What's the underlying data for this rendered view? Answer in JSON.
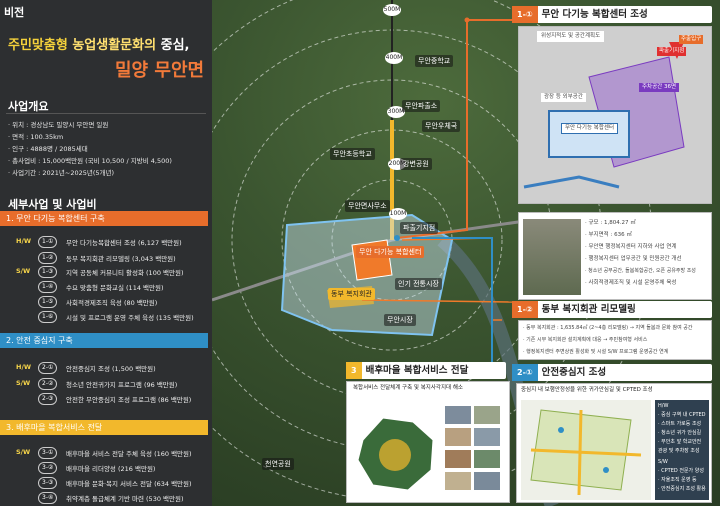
{
  "top_tag": "비전",
  "title": {
    "part1": "주민맞춤형",
    "part2": "농업생활문화의",
    "part3": "중심,",
    "main": "밀양 무안면"
  },
  "overview": {
    "heading": "사업개요",
    "lines": [
      "· 위치 : 경상남도 밀양시 무안면 일원",
      "· 면적 : 100.35km",
      "· 인구 : 4888명 / 2085세대",
      "· 총사업비 : 15,000백만원 (국비 10,500 / 지방비 4,500)",
      "· 사업기간 : 2021년~2025년(5개년)"
    ]
  },
  "details_heading": "세부사업 및 사업비",
  "sections": [
    {
      "title": "1. 무안 다기능 복합센터 구축",
      "rows": [
        {
          "cat": "H/W",
          "badge": "1-①",
          "text": "무안 다기능복합센터 조성 (6,127 백만원)"
        },
        {
          "cat": "",
          "badge": "1-②",
          "text": "동부 복지회관 리모델링 (3,043 백만원)"
        },
        {
          "cat": "S/W",
          "badge": "1-③",
          "text": "지역 공동체 커뮤니티 활성화 (100 백만원)"
        },
        {
          "cat": "",
          "badge": "1-④",
          "text": "수요 맞춤형 문화교실 (114 백만원)"
        },
        {
          "cat": "",
          "badge": "1-⑤",
          "text": "사회적경제조직 육성 (80 백만원)"
        },
        {
          "cat": "",
          "badge": "1-⑥",
          "text": "시설 및 프로그램 운영 주체 육성 (135 백만원)"
        }
      ]
    },
    {
      "title": "2. 안전 중심지 구축",
      "rows": [
        {
          "cat": "H/W",
          "badge": "2-①",
          "text": "안전중심지 조성 (1,500 백만원)"
        },
        {
          "cat": "S/W",
          "badge": "2-②",
          "text": "청소년 안전귀가지 프로그램 (96 백만원)"
        },
        {
          "cat": "",
          "badge": "2-③",
          "text": "안전한 무안중심지 조성 프로그램 (86 백만원)"
        }
      ]
    },
    {
      "title": "3. 배후마을 복합서비스 전달",
      "rows": [
        {
          "cat": "S/W",
          "badge": "3-①",
          "text": "배후마을 서비스 전달 주체 육성 (160 백만원)"
        },
        {
          "cat": "",
          "badge": "3-②",
          "text": "배후마을 리더양성 (216 백만원)"
        },
        {
          "cat": "",
          "badge": "3-③",
          "text": "배후마을 문화·복지 서비스 전달 (634 백만원)"
        },
        {
          "cat": "",
          "badge": "3-④",
          "text": "취약계층 돌급체계 기반 마련 (530 백만원)"
        }
      ]
    }
  ],
  "distances": [
    "500M",
    "400M",
    "300M",
    "200M",
    "100M"
  ],
  "map_labels": [
    "무안 다기능 복합센터",
    "동부 복지회관",
    "무안초등학교",
    "무안중학교",
    "무안파출소",
    "인기 전통시장",
    "무안면사무소",
    "파출기지점",
    "무안시장",
    "무안우체국",
    "강변공원",
    "천연공원"
  ],
  "panel1": {
    "num": "1-①",
    "title": "무안 다기능 복합센터 조성",
    "labels": [
      "위성지적도 및 공간계획도",
      "광장 등 외부공간",
      "무안 다기능 복합센터",
      "주차공간 36면",
      "파출기지점",
      "주출입구"
    ]
  },
  "panel2": {
    "num": "1-②",
    "title": "동부 복지회관 리모델링",
    "specs": [
      "· 규모 : 1,804.27 ㎡",
      "· 부지면적 : 636 ㎡",
      "· 무안면 행정복지센터 지하와 사업 연계",
      "· 행정복지센터 업무공간 및 민원공간 개선",
      "· 청소년 공부공간, 돌봄복합공간, 오픈 공유주방 조성",
      "· 사회적경제조직 및 시설 운영주체 육성"
    ],
    "lines": [
      "· 동부 복지회관 : 1,635.84㎡ (2~4층 리모델링) → 지역 돌봄과 문화 참여 공간",
      "· 기존 시부 복지회관 설치계획에 대응 → 주민참여형 서비스",
      "· 행정복지센터 주변상권 활성화 및 시설 S/W 프로그램 운영공간 연계"
    ]
  },
  "panel3": {
    "num": "3",
    "title": "배후마을 복합서비스 전달",
    "sub": "복합서비스 전달체계 구축 및 복지사각지대 해소"
  },
  "panel4": {
    "num": "2-①",
    "title": "안전중심지 조성",
    "sub": "중심지 내 보행안정성을 위한 귀가안심길 및 CPTED 조성",
    "items": [
      "H/W",
      "· 중심 구역 내 CPTED",
      "· 스마트 가로등 조성",
      "· 청소년 귀가 안심길",
      "· 무안초 앞 학교안전",
      "관광 및 주차장 조성",
      "S/W",
      "· CPTED 전문가 양성",
      "· 자율조직 운영 등",
      "· 안전중심지 조성 활용"
    ]
  }
}
